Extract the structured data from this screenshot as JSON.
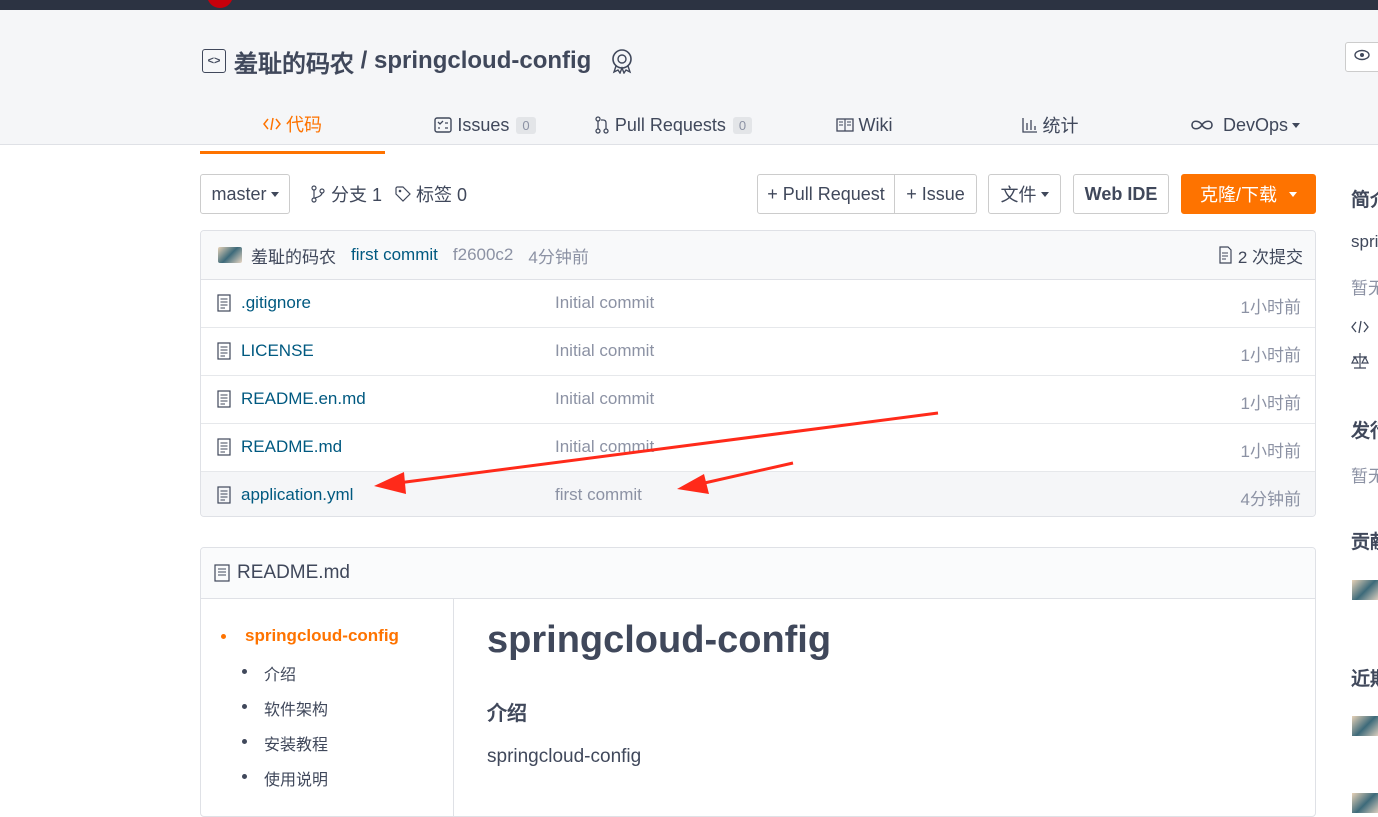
{
  "repo": {
    "owner": "羞耻的码农",
    "separator": " / ",
    "name": "springcloud-config"
  },
  "tabs": [
    {
      "label": "代码",
      "icon": "code-icon",
      "active": true
    },
    {
      "label": "Issues",
      "icon": "issues-icon",
      "count": "0"
    },
    {
      "label": "Pull Requests",
      "icon": "pull-request-icon",
      "count": "0"
    },
    {
      "label": "Wiki",
      "icon": "book-icon"
    },
    {
      "label": "统计",
      "icon": "chart-icon"
    },
    {
      "label": "DevOps",
      "icon": "infinity-icon"
    }
  ],
  "toolbar": {
    "branch": "master",
    "branches_label": "分支 1",
    "tags_label": "标签 0",
    "pull_request_label": "+ Pull Request",
    "issue_label": "+ Issue",
    "file_label": "文件",
    "web_ide_label": "Web IDE",
    "clone_label": "克隆/下载"
  },
  "latest_commit": {
    "author": "羞耻的码农",
    "message": "first commit",
    "hash": "f2600c2",
    "time": "4分钟前",
    "commits_label": "2 次提交"
  },
  "files": [
    {
      "name": ".gitignore",
      "message": "Initial commit",
      "time": "1小时前"
    },
    {
      "name": "LICENSE",
      "message": "Initial commit",
      "time": "1小时前"
    },
    {
      "name": "README.en.md",
      "message": "Initial commit",
      "time": "1小时前"
    },
    {
      "name": "README.md",
      "message": "Initial commit",
      "time": "1小时前"
    },
    {
      "name": "application.yml",
      "message": "first commit",
      "time": "4分钟前"
    }
  ],
  "readme": {
    "filename": "README.md",
    "toc": [
      "springcloud-config",
      "介绍",
      "软件架构",
      "安装教程",
      "使用说明"
    ],
    "title": "springcloud-config",
    "section_heading": "介绍",
    "section_text": "springcloud-config"
  },
  "sidebar": {
    "intro_heading": "简介",
    "intro_text": "spri",
    "intro_empty": "暂无",
    "releases_heading": "发行",
    "releases_empty": "暂无",
    "contributors_heading": "贡献",
    "recent_heading": "近期"
  },
  "colors": {
    "accent": "#fe7300",
    "link": "#005980",
    "annotation_arrow": "#ff2a1a",
    "topbar": "#2c3342"
  }
}
